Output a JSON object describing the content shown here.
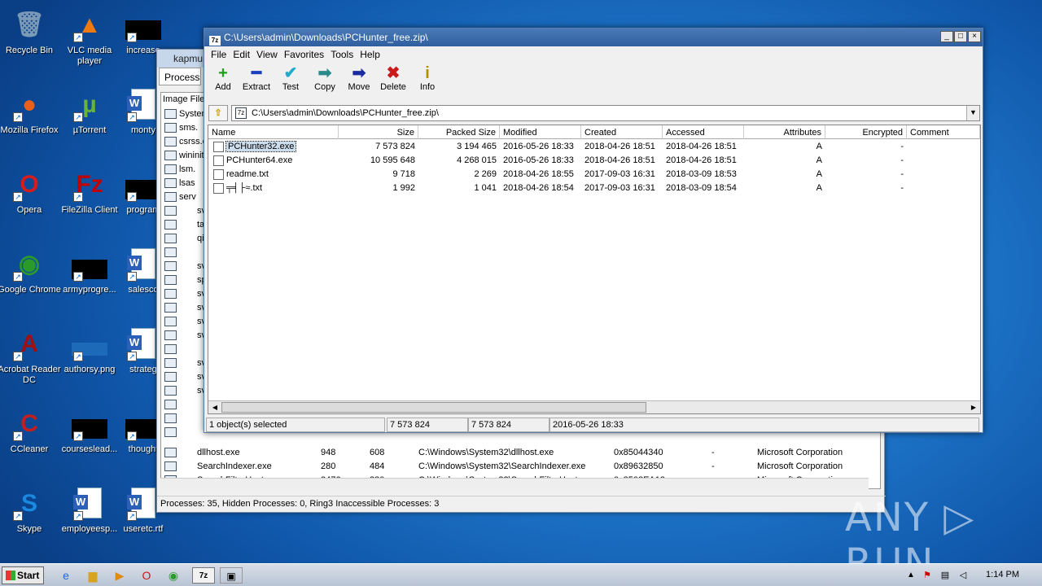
{
  "desktop": {
    "icons": [
      {
        "label": "Recycle Bin",
        "glyph": "🗑"
      },
      {
        "label": "VLC media player",
        "glyph": "▲"
      },
      {
        "label": "increase",
        "glyph": ""
      },
      {
        "label": "Mozilla Firefox",
        "glyph": "●"
      },
      {
        "label": "µTorrent",
        "glyph": "µ"
      },
      {
        "label": "monty",
        "glyph": ""
      },
      {
        "label": "Opera",
        "glyph": "O"
      },
      {
        "label": "FileZilla Client",
        "glyph": "Fz"
      },
      {
        "label": "program",
        "glyph": ""
      },
      {
        "label": "Google Chrome",
        "glyph": "◉"
      },
      {
        "label": "armyprogre...",
        "glyph": ""
      },
      {
        "label": "salesco",
        "glyph": ""
      },
      {
        "label": "Acrobat Reader DC",
        "glyph": "A"
      },
      {
        "label": "authorsy.png",
        "glyph": ""
      },
      {
        "label": "strateg",
        "glyph": ""
      },
      {
        "label": "CCleaner",
        "glyph": "C"
      },
      {
        "label": "courseslead...",
        "glyph": ""
      },
      {
        "label": "thought",
        "glyph": ""
      },
      {
        "label": "Skype",
        "glyph": "S"
      },
      {
        "label": "employeesp...",
        "glyph": ""
      },
      {
        "label": "useretc.rtf",
        "glyph": ""
      }
    ]
  },
  "process_hacker": {
    "title": "kapmu",
    "tab": "Process",
    "col_header": "Image File",
    "left_items": [
      "System",
      "sms.",
      "csrss.e",
      "wininit",
      "lsm.",
      "lsas",
      "serv",
      "sv",
      "ta",
      "qi",
      "",
      "sv",
      "sp",
      "sv",
      "sv",
      "sv",
      "sv",
      "",
      "sv",
      "sv",
      "sv",
      "",
      "",
      ""
    ],
    "rows": [
      {
        "name": "dllhost.exe",
        "pid": "948",
        "threads": "608",
        "path": "C:\\Windows\\System32\\dllhost.exe",
        "addr": "0x85044340",
        "dash": "-",
        "company": "Microsoft Corporation"
      },
      {
        "name": "SearchIndexer.exe",
        "pid": "280",
        "threads": "484",
        "path": "C:\\Windows\\System32\\SearchIndexer.exe",
        "addr": "0x89632850",
        "dash": "-",
        "company": "Microsoft Corporation"
      },
      {
        "name": "SearchFilterHost.exe",
        "pid": "2476",
        "threads": "280",
        "path": "C:\\Windows\\System32\\SearchFilterHost.exe",
        "addr": "0x8508EA18",
        "dash": "-",
        "company": "Microsoft Corporation"
      }
    ],
    "status": "Processes: 35, Hidden Processes: 0, Ring3 Inaccessible Processes: 3"
  },
  "zip": {
    "title": "C:\\Users\\admin\\Downloads\\PCHunter_free.zip\\",
    "logo": "7z",
    "menu": [
      "File",
      "Edit",
      "View",
      "Favorites",
      "Tools",
      "Help"
    ],
    "toolbar": [
      {
        "label": "Add",
        "glyph": "+",
        "color": "#1aa31a"
      },
      {
        "label": "Extract",
        "glyph": "━",
        "color": "#1a3fbf"
      },
      {
        "label": "Test",
        "glyph": "✔",
        "color": "#22aacc"
      },
      {
        "label": "Copy",
        "glyph": "➡",
        "color": "#2a8a8a"
      },
      {
        "label": "Move",
        "glyph": "➡",
        "color": "#1a2aa0"
      },
      {
        "label": "Delete",
        "glyph": "✖",
        "color": "#cc1a1a"
      },
      {
        "label": "Info",
        "glyph": "i",
        "color": "#b09000"
      }
    ],
    "address": "C:\\Users\\admin\\Downloads\\PCHunter_free.zip\\",
    "columns": [
      "Name",
      "Size",
      "Packed Size",
      "Modified",
      "Created",
      "Accessed",
      "Attributes",
      "Encrypted",
      "Comment"
    ],
    "files": [
      {
        "name": "PCHunter32.exe",
        "size": "7 573 824",
        "packed": "3 194 465",
        "modified": "2016-05-26 18:33",
        "created": "2018-04-26 18:51",
        "accessed": "2018-04-26 18:51",
        "attr": "A",
        "enc": "-"
      },
      {
        "name": "PCHunter64.exe",
        "size": "10 595 648",
        "packed": "4 268 015",
        "modified": "2016-05-26 18:33",
        "created": "2018-04-26 18:51",
        "accessed": "2018-04-26 18:51",
        "attr": "A",
        "enc": "-"
      },
      {
        "name": "readme.txt",
        "size": "9 718",
        "packed": "2 269",
        "modified": "2018-04-26 18:55",
        "created": "2017-09-03 16:31",
        "accessed": "2018-03-09 18:53",
        "attr": "A",
        "enc": "-"
      },
      {
        "name": "╤╡├≈.txt",
        "size": "1 992",
        "packed": "1 041",
        "modified": "2018-04-26 18:54",
        "created": "2017-09-03 16:31",
        "accessed": "2018-03-09 18:54",
        "attr": "A",
        "enc": "-"
      }
    ],
    "status": [
      "1 object(s) selected",
      "7 573 824",
      "7 573 824",
      "2016-05-26 18:33"
    ]
  },
  "taskbar": {
    "start": "Start",
    "clock": "1:14 PM"
  },
  "watermark": "ANY ▷ RUN"
}
